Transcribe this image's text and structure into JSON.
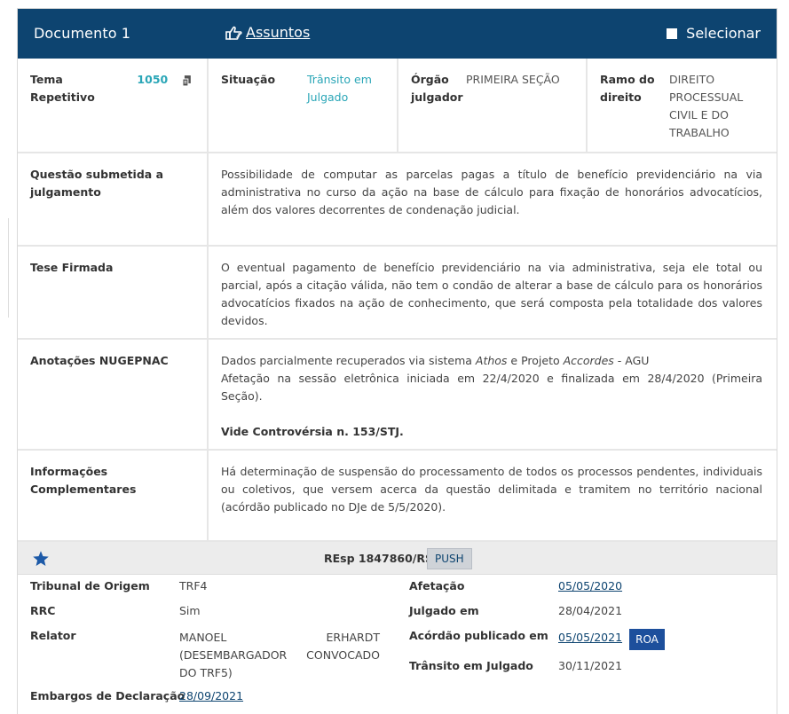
{
  "header": {
    "title": "Documento 1",
    "assuntos_label": "Assuntos",
    "select_label": "Selecionar"
  },
  "row1": {
    "tema_label": "Tema Repetitivo",
    "tema_number": "1050",
    "situacao_label": "Situação",
    "situacao_value_l1": "Trânsito em",
    "situacao_value_l2": "Julgado",
    "orgao_label_l1": "Órgão",
    "orgao_label_l2": "julgador",
    "orgao_value": "PRIMEIRA SEÇÃO",
    "ramo_label_l1": "Ramo do",
    "ramo_label_l2": "direito",
    "ramo_value_l1": "DIREITO",
    "ramo_value_l2": "PROCESSUAL",
    "ramo_value_l3": "CIVIL E DO",
    "ramo_value_l4": "TRABALHO"
  },
  "questao": {
    "label_l1": "Questão submetida a",
    "label_l2": "julgamento",
    "text": "Possibilidade de computar as parcelas pagas a título de benefício previdenciário na via administrativa no curso da ação na base de cálculo para fixação de honorários advocatícios, além dos valores decorrentes de condenação judicial."
  },
  "tese": {
    "label": "Tese Firmada",
    "text": "O eventual pagamento de benefício previdenciário na via administrativa, seja ele total ou parcial, após a citação válida, não tem o condão de alterar a base de cálculo para os honorários advocatícios fixados na ação de conhecimento, que será composta pela totalidade dos valores devidos."
  },
  "anotacoes": {
    "label": "Anotações NUGEPNAC",
    "line1_a": "Dados parcialmente recuperados via sistema ",
    "line1_b": "Athos",
    "line1_c": " e Projeto ",
    "line1_d": "Accordes",
    "line1_e": " - AGU",
    "line2": "Afetação na sessão eletrônica iniciada em 22/4/2020 e finalizada em 28/4/2020 (Primeira Seção).",
    "line3": "Vide Controvérsia n. 153/STJ."
  },
  "info": {
    "label": "Informações Complementares",
    "text": "Há determinação de suspensão do processamento de todos os processos pendentes, individuais ou coletivos, que versem acerca da questão delimitada e tramitem no território nacional (acórdão publicado no DJe de 5/5/2020)."
  },
  "processo": {
    "resp": "REsp 1847860/RS",
    "push_label": "PUSH",
    "tribunal_label": "Tribunal de Origem",
    "tribunal_value": "TRF4",
    "rrc_label": "RRC",
    "rrc_value": "Sim",
    "relator_label": "Relator",
    "relator_value": "MANOEL ERHARDT (DESEMBARGADOR CONVOCADO DO TRF5)",
    "embargos_label": "Embargos de Declaração",
    "embargos_value": "28/09/2021",
    "afetacao_label": "Afetação",
    "afetacao_value": "05/05/2020",
    "julgado_label": "Julgado em",
    "julgado_value": "28/04/2021",
    "acordao_label": "Acórdão publicado em",
    "acordao_value": "05/05/2021",
    "roa_label": "ROA",
    "transito_label": "Trânsito em Julgado",
    "transito_value": "30/11/2021"
  },
  "colors": {
    "header_bg": "#0d4470",
    "teal": "#2aa6b7",
    "roa_bg": "#1d4f9c"
  }
}
